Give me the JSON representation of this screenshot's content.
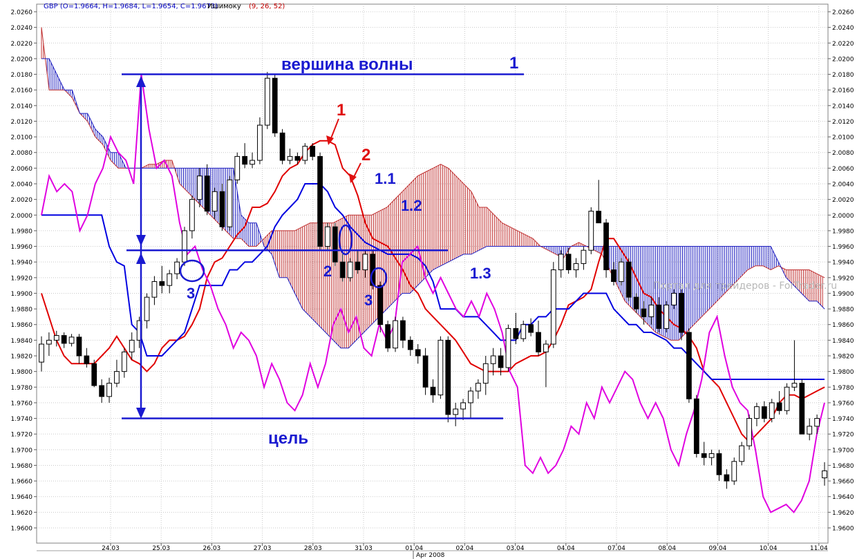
{
  "header": {
    "symbol_ohlc": "GBP (O=1.9664, H=1.9684, L=1.9654, C=1.9673)",
    "indicator_name": "Ишимоку",
    "indicator_params": "(9, 26, 52)"
  },
  "watermark": "Портал для трейдеров - ForTrader.ru",
  "bottom_bar": {
    "month_label": "Apr 2008"
  },
  "colors": {
    "background": "#ffffff",
    "grid": "#c8c8c8",
    "tenkan": "#e00000",
    "kijun": "#0000e0",
    "chikou": "#e000e0",
    "cloud_bull": "#2020c0",
    "cloud_bear": "#c03030",
    "annotation_blue": "#1a1ad0",
    "annotation_red": "#e01010",
    "candle_bull": "#ffffff",
    "candle_bear": "#000000",
    "ohlc_value": "#0000c0",
    "indicator_param": "#c00000"
  },
  "annotations": {
    "wave_top_label": "вершина волны",
    "target_label": "цель",
    "wave_top_number": "1",
    "red_1": "1",
    "red_2": "2",
    "blue_1_1": "1.1",
    "blue_1_2": "1.2",
    "blue_1_3": "1.3",
    "blue_2": "2",
    "blue_3a": "3",
    "blue_3b": "3"
  },
  "chart_data": {
    "type": "candlestick",
    "ylim": [
      1.96,
      2.026
    ],
    "y_ticks": [
      "2.0260",
      "2.0240",
      "2.0220",
      "2.0200",
      "2.0180",
      "2.0160",
      "2.0140",
      "2.0120",
      "2.0100",
      "2.0080",
      "2.0060",
      "2.0040",
      "2.0020",
      "2.0000",
      "1.9980",
      "1.9960",
      "1.9940",
      "1.9920",
      "1.9900",
      "1.9880",
      "1.9860",
      "1.9840",
      "1.9820",
      "1.9800",
      "1.9780",
      "1.9760",
      "1.9740",
      "1.9720",
      "1.9700",
      "1.9680",
      "1.9660",
      "1.9640",
      "1.9620",
      "1.9600"
    ],
    "x_tick_labels": [
      "24.03",
      "25.03",
      "26.03",
      "27.03",
      "28.03",
      "31.03",
      "01.04",
      "02.04",
      "03.04",
      "04.04",
      "07.04",
      "08.04",
      "09.04",
      "10.04",
      "11.04"
    ],
    "candles": [
      [
        1.9812,
        1.9845,
        1.98,
        1.9835
      ],
      [
        1.9835,
        1.985,
        1.982,
        1.984
      ],
      [
        1.984,
        1.9852,
        1.9832,
        1.9846
      ],
      [
        1.9846,
        1.985,
        1.983,
        1.9836
      ],
      [
        1.9836,
        1.9848,
        1.9832,
        1.9844
      ],
      [
        1.9844,
        1.9848,
        1.981,
        1.982
      ],
      [
        1.982,
        1.983,
        1.9805,
        1.981
      ],
      [
        1.981,
        1.9815,
        1.978,
        1.9782
      ],
      [
        1.9782,
        1.979,
        1.976,
        1.9768
      ],
      [
        1.9768,
        1.9792,
        1.976,
        1.9785
      ],
      [
        1.9785,
        1.9815,
        1.978,
        1.98
      ],
      [
        1.98,
        1.983,
        1.9792,
        1.9825
      ],
      [
        1.9825,
        1.985,
        1.9815,
        1.984
      ],
      [
        1.984,
        1.987,
        1.983,
        1.9865
      ],
      [
        1.9865,
        1.99,
        1.9855,
        1.9895
      ],
      [
        1.9895,
        1.9922,
        1.9885,
        1.9915
      ],
      [
        1.9915,
        1.9935,
        1.99,
        1.991
      ],
      [
        1.991,
        1.993,
        1.99,
        1.9925
      ],
      [
        1.9925,
        1.9945,
        1.9918,
        1.994
      ],
      [
        1.994,
        1.9985,
        1.9935,
        1.998
      ],
      [
        1.998,
        2.0025,
        1.997,
        2.002
      ],
      [
        2.002,
        2.006,
        2.001,
        2.005
      ],
      [
        2.005,
        2.0065,
        2.0,
        2.0005
      ],
      [
        2.0005,
        2.0035,
        1.9995,
        2.003
      ],
      [
        2.003,
        2.004,
        1.998,
        1.9985
      ],
      [
        1.9985,
        2.005,
        1.998,
        2.0045
      ],
      [
        2.0045,
        2.008,
        2.004,
        2.0075
      ],
      [
        2.0075,
        2.0092,
        2.006,
        2.0065
      ],
      [
        2.0065,
        2.008,
        2.006,
        2.007
      ],
      [
        2.007,
        2.0125,
        2.0065,
        2.0115
      ],
      [
        2.0115,
        2.0183,
        2.011,
        2.0175
      ],
      [
        2.0175,
        2.018,
        2.01,
        2.0105
      ],
      [
        2.0105,
        2.011,
        2.0065,
        2.007
      ],
      [
        2.007,
        2.0085,
        2.0065,
        2.0075
      ],
      [
        2.0075,
        2.008,
        2.0065,
        2.007
      ],
      [
        2.007,
        2.0092,
        2.0065,
        2.0088
      ],
      [
        2.0088,
        2.0092,
        2.007,
        2.0075
      ],
      [
        2.0075,
        2.008,
        1.9955,
        1.996
      ],
      [
        1.996,
        1.999,
        1.9955,
        1.9985
      ],
      [
        1.9985,
        1.999,
        1.9935,
        1.994
      ],
      [
        1.994,
        1.9955,
        1.9915,
        1.992
      ],
      [
        1.992,
        1.9945,
        1.9915,
        1.994
      ],
      [
        1.994,
        1.9955,
        1.9925,
        1.993
      ],
      [
        1.993,
        1.9955,
        1.992,
        1.995
      ],
      [
        1.995,
        1.9955,
        1.9905,
        1.991
      ],
      [
        1.991,
        1.9915,
        1.985,
        1.986
      ],
      [
        1.986,
        1.9865,
        1.9825,
        1.983
      ],
      [
        1.983,
        1.987,
        1.9825,
        1.9865
      ],
      [
        1.9865,
        1.987,
        1.983,
        1.984
      ],
      [
        1.984,
        1.9845,
        1.982,
        1.9828
      ],
      [
        1.9828,
        1.9835,
        1.981,
        1.982
      ],
      [
        1.982,
        1.983,
        1.977,
        1.978
      ],
      [
        1.978,
        1.979,
        1.976,
        1.977
      ],
      [
        1.977,
        1.9845,
        1.9765,
        1.984
      ],
      [
        1.984,
        1.9845,
        1.9735,
        1.9745
      ],
      [
        1.9745,
        1.976,
        1.973,
        1.9752
      ],
      [
        1.9752,
        1.9765,
        1.9738,
        1.976
      ],
      [
        1.976,
        1.978,
        1.974,
        1.9775
      ],
      [
        1.9775,
        1.979,
        1.9765,
        1.9785
      ],
      [
        1.9785,
        1.982,
        1.977,
        1.981
      ],
      [
        1.981,
        1.983,
        1.9795,
        1.982
      ],
      [
        1.982,
        1.983,
        1.9795,
        1.9805
      ],
      [
        1.9805,
        1.986,
        1.98,
        1.9855
      ],
      [
        1.9855,
        1.9875,
        1.9835,
        1.9842
      ],
      [
        1.9842,
        1.9865,
        1.9838,
        1.986
      ],
      [
        1.986,
        1.9868,
        1.9845,
        1.985
      ],
      [
        1.985,
        1.9865,
        1.982,
        1.9825
      ],
      [
        1.9825,
        1.984,
        1.978,
        1.9835
      ],
      [
        1.9835,
        1.994,
        1.983,
        1.993
      ],
      [
        1.993,
        1.9955,
        1.992,
        1.995
      ],
      [
        1.995,
        1.9958,
        1.9925,
        1.993
      ],
      [
        1.993,
        1.9945,
        1.992,
        1.9938
      ],
      [
        1.9938,
        1.996,
        1.993,
        1.9955
      ],
      [
        1.9955,
        2.001,
        1.995,
        2.0005
      ],
      [
        2.0005,
        2.0045,
        1.999,
        1.999
      ],
      [
        1.999,
        1.9995,
        1.992,
        1.993
      ],
      [
        1.993,
        1.994,
        1.991,
        1.9915
      ],
      [
        1.9915,
        1.9945,
        1.991,
        1.994
      ],
      [
        1.994,
        1.9945,
        1.989,
        1.9895
      ],
      [
        1.9895,
        1.99,
        1.9875,
        1.988
      ],
      [
        1.988,
        1.989,
        1.986,
        1.987
      ],
      [
        1.987,
        1.9895,
        1.986,
        1.9885
      ],
      [
        1.9885,
        1.9895,
        1.985,
        1.9855
      ],
      [
        1.9855,
        1.989,
        1.985,
        1.9885
      ],
      [
        1.9885,
        1.9905,
        1.988,
        1.99
      ],
      [
        1.99,
        1.9905,
        1.984,
        1.985
      ],
      [
        1.985,
        1.9855,
        1.976,
        1.9765
      ],
      [
        1.9765,
        1.977,
        1.969,
        1.9695
      ],
      [
        1.9695,
        1.971,
        1.968,
        1.969
      ],
      [
        1.969,
        1.97,
        1.968,
        1.9695
      ],
      [
        1.9695,
        1.97,
        1.966,
        1.9668
      ],
      [
        1.9668,
        1.9675,
        1.965,
        1.966
      ],
      [
        1.966,
        1.969,
        1.9655,
        1.9685
      ],
      [
        1.9685,
        1.971,
        1.968,
        1.9705
      ],
      [
        1.9705,
        1.9745,
        1.97,
        1.974
      ],
      [
        1.974,
        1.976,
        1.973,
        1.9755
      ],
      [
        1.9755,
        1.9762,
        1.9735,
        1.974
      ],
      [
        1.974,
        1.9765,
        1.9735,
        1.976
      ],
      [
        1.976,
        1.9775,
        1.9745,
        1.975
      ],
      [
        1.975,
        1.9785,
        1.9745,
        1.978
      ],
      [
        1.978,
        1.984,
        1.9775,
        1.9785
      ],
      [
        1.9785,
        1.979,
        1.972,
        1.972
      ],
      [
        1.972,
        1.974,
        1.9712,
        1.973
      ],
      [
        1.973,
        1.9745,
        1.972,
        1.974
      ],
      [
        1.9664,
        1.9684,
        1.9654,
        1.9673
      ]
    ],
    "series": [
      {
        "name": "Tenkan",
        "values": [
          1.99,
          1.987,
          1.984,
          1.982,
          1.981,
          1.981,
          1.981,
          1.981,
          1.982,
          1.983,
          1.9845,
          1.983,
          1.9815,
          1.981,
          1.98,
          1.981,
          1.983,
          1.984,
          1.984,
          1.9845,
          1.986,
          1.988,
          1.992,
          1.994,
          1.9945,
          1.996,
          1.9975,
          1.9985,
          2.001,
          2.001,
          2.0015,
          2.003,
          2.005,
          2.006,
          2.0065,
          2.008,
          2.009,
          2.0095,
          2.0095,
          2.009,
          2.006,
          2.005,
          2.0025,
          1.999,
          1.997,
          1.9965,
          1.996,
          1.9945,
          1.993,
          1.991,
          1.99,
          1.988,
          1.987,
          1.986,
          1.985,
          1.984,
          1.9825,
          1.981,
          1.9805,
          1.98,
          1.98,
          1.98,
          1.98,
          1.981,
          1.9815,
          1.982,
          1.982,
          1.9825,
          1.984,
          1.986,
          1.9885,
          1.989,
          1.9895,
          1.9905,
          1.994,
          1.997,
          1.997,
          1.9955,
          1.994,
          1.992,
          1.99,
          1.9895,
          1.988,
          1.987,
          1.986,
          1.9855,
          1.9845,
          1.983,
          1.98,
          1.979,
          1.978,
          1.976,
          1.974,
          1.972,
          1.971,
          1.972,
          1.973,
          1.974,
          1.976,
          1.977,
          1.977,
          1.9765,
          1.977,
          1.9775,
          1.978
        ]
      },
      {
        "name": "Kijun",
        "values": [
          2.0,
          2.0,
          2.0,
          2.0,
          2.0,
          2.0,
          2.0,
          2.0,
          2.0,
          1.996,
          1.994,
          1.9935,
          1.986,
          1.985,
          1.982,
          1.982,
          1.982,
          1.983,
          1.984,
          1.985,
          1.988,
          1.991,
          1.991,
          1.991,
          1.991,
          1.993,
          1.993,
          1.994,
          1.994,
          1.995,
          1.996,
          1.9985,
          2.0,
          2.001,
          2.002,
          2.004,
          2.004,
          2.004,
          2.003,
          2.001,
          2.0,
          1.9985,
          1.9975,
          1.9965,
          1.996,
          1.9955,
          1.995,
          1.995,
          1.995,
          1.995,
          1.9945,
          1.9935,
          1.9915,
          1.988,
          1.988,
          1.988,
          1.987,
          1.987,
          1.987,
          1.986,
          1.985,
          1.984,
          1.984,
          1.984,
          1.986,
          1.986,
          1.987,
          1.987,
          1.988,
          1.988,
          1.988,
          1.989,
          1.99,
          1.99,
          1.99,
          1.99,
          1.988,
          1.987,
          1.986,
          1.986,
          1.985,
          1.985,
          1.9845,
          1.984,
          1.983,
          1.983,
          1.982,
          1.981,
          1.98,
          1.979,
          1.979,
          1.979,
          1.979,
          1.979,
          1.979,
          1.979,
          1.979,
          1.979,
          1.979,
          1.979,
          1.979,
          1.979,
          1.979,
          1.979,
          1.979
        ]
      },
      {
        "name": "Chikou",
        "values": [
          2.0,
          2.005,
          2.003,
          2.004,
          2.003,
          1.998,
          2.0,
          2.004,
          2.006,
          2.01,
          2.008,
          2.007,
          2.004,
          2.018,
          2.011,
          2.006,
          2.007,
          2.005,
          1.999,
          1.995,
          1.996,
          1.993,
          1.991,
          1.988,
          1.986,
          1.983,
          1.985,
          1.984,
          1.982,
          1.978,
          1.981,
          1.979,
          1.976,
          1.975,
          1.977,
          1.981,
          1.978,
          1.981,
          1.986,
          1.988,
          1.985,
          1.987,
          1.983,
          1.982,
          1.986,
          1.984,
          1.986,
          1.994,
          1.995,
          1.996,
          1.992,
          1.99,
          1.992,
          1.99,
          1.988,
          1.987,
          1.989,
          1.987,
          1.99,
          1.988,
          1.985,
          1.98,
          1.978,
          1.968,
          1.967,
          1.969,
          1.967,
          1.968,
          1.97,
          1.973,
          1.972,
          1.976,
          1.974,
          1.978,
          1.976,
          1.978,
          1.98,
          1.979,
          1.976,
          1.974,
          1.976,
          1.974,
          1.97,
          1.968,
          1.972,
          1.975,
          1.979,
          1.985,
          1.987,
          1.982,
          1.978,
          1.976,
          1.975,
          1.97,
          1.964,
          1.962,
          1.9625,
          1.963,
          1.962,
          1.9635,
          1.966,
          1.972,
          1.976
        ]
      },
      {
        "name": "Senkou A",
        "values": [
          2.024,
          2.016,
          2.016,
          2.016,
          2.015,
          2.013,
          2.012,
          2.01,
          2.009,
          2.007,
          2.006,
          2.006,
          2.006,
          2.006,
          2.0065,
          2.0065,
          2.007,
          2.007,
          2.004,
          2.003,
          2.002,
          2.001,
          2.0,
          1.999,
          1.998,
          1.997,
          1.997,
          1.996,
          1.996,
          1.997,
          1.998,
          1.998,
          1.998,
          1.998,
          1.9985,
          1.999,
          1.999,
          1.999,
          1.999,
          1.9995,
          2.0,
          2.0,
          2.0,
          2.0,
          2.0005,
          2.001,
          2.002,
          2.003,
          2.004,
          2.005,
          2.0055,
          2.006,
          2.0065,
          2.006,
          2.005,
          2.004,
          2.003,
          2.001,
          2.001,
          2.0,
          1.999,
          1.9985,
          1.998,
          1.9975,
          1.997,
          1.996,
          1.9955,
          1.995,
          1.9945,
          1.996,
          1.9965,
          1.996,
          1.9955,
          1.995,
          1.993,
          1.991,
          1.989,
          1.988,
          1.987,
          1.986,
          1.985,
          1.9845,
          1.984,
          1.984,
          1.985,
          1.986,
          1.987,
          1.988,
          1.989,
          1.99,
          1.991,
          1.992,
          1.993,
          1.9935,
          1.9935,
          1.993,
          1.9935,
          1.993,
          1.993,
          1.993,
          1.993,
          1.9925,
          1.992
        ]
      },
      {
        "name": "Senkou B",
        "values": [
          2.02,
          2.02,
          2.018,
          2.016,
          2.016,
          2.013,
          2.013,
          2.011,
          2.01,
          2.008,
          2.008,
          2.006,
          2.006,
          2.006,
          2.006,
          2.006,
          2.006,
          2.006,
          2.006,
          2.006,
          2.006,
          2.006,
          2.006,
          2.006,
          2.006,
          2.006,
          2.0,
          1.999,
          1.999,
          1.996,
          1.995,
          1.992,
          1.992,
          1.99,
          1.988,
          1.987,
          1.986,
          1.985,
          1.984,
          1.983,
          1.983,
          1.984,
          1.985,
          1.986,
          1.987,
          1.988,
          1.989,
          1.99,
          1.99,
          1.991,
          1.992,
          1.993,
          1.9935,
          1.994,
          1.9945,
          1.995,
          1.995,
          1.9955,
          1.996,
          1.996,
          1.996,
          1.996,
          1.996,
          1.996,
          1.996,
          1.996,
          1.996,
          1.996,
          1.996,
          1.996,
          1.996,
          1.996,
          1.996,
          1.996,
          1.996,
          1.996,
          1.996,
          1.996,
          1.996,
          1.996,
          1.996,
          1.996,
          1.996,
          1.996,
          1.996,
          1.996,
          1.996,
          1.996,
          1.996,
          1.996,
          1.996,
          1.996,
          1.996,
          1.996,
          1.996,
          1.996,
          1.994,
          1.992,
          1.991,
          1.99,
          1.989,
          1.989,
          1.988
        ]
      }
    ],
    "levels": [
      2.018,
      1.9955,
      1.974
    ],
    "grid": true
  }
}
